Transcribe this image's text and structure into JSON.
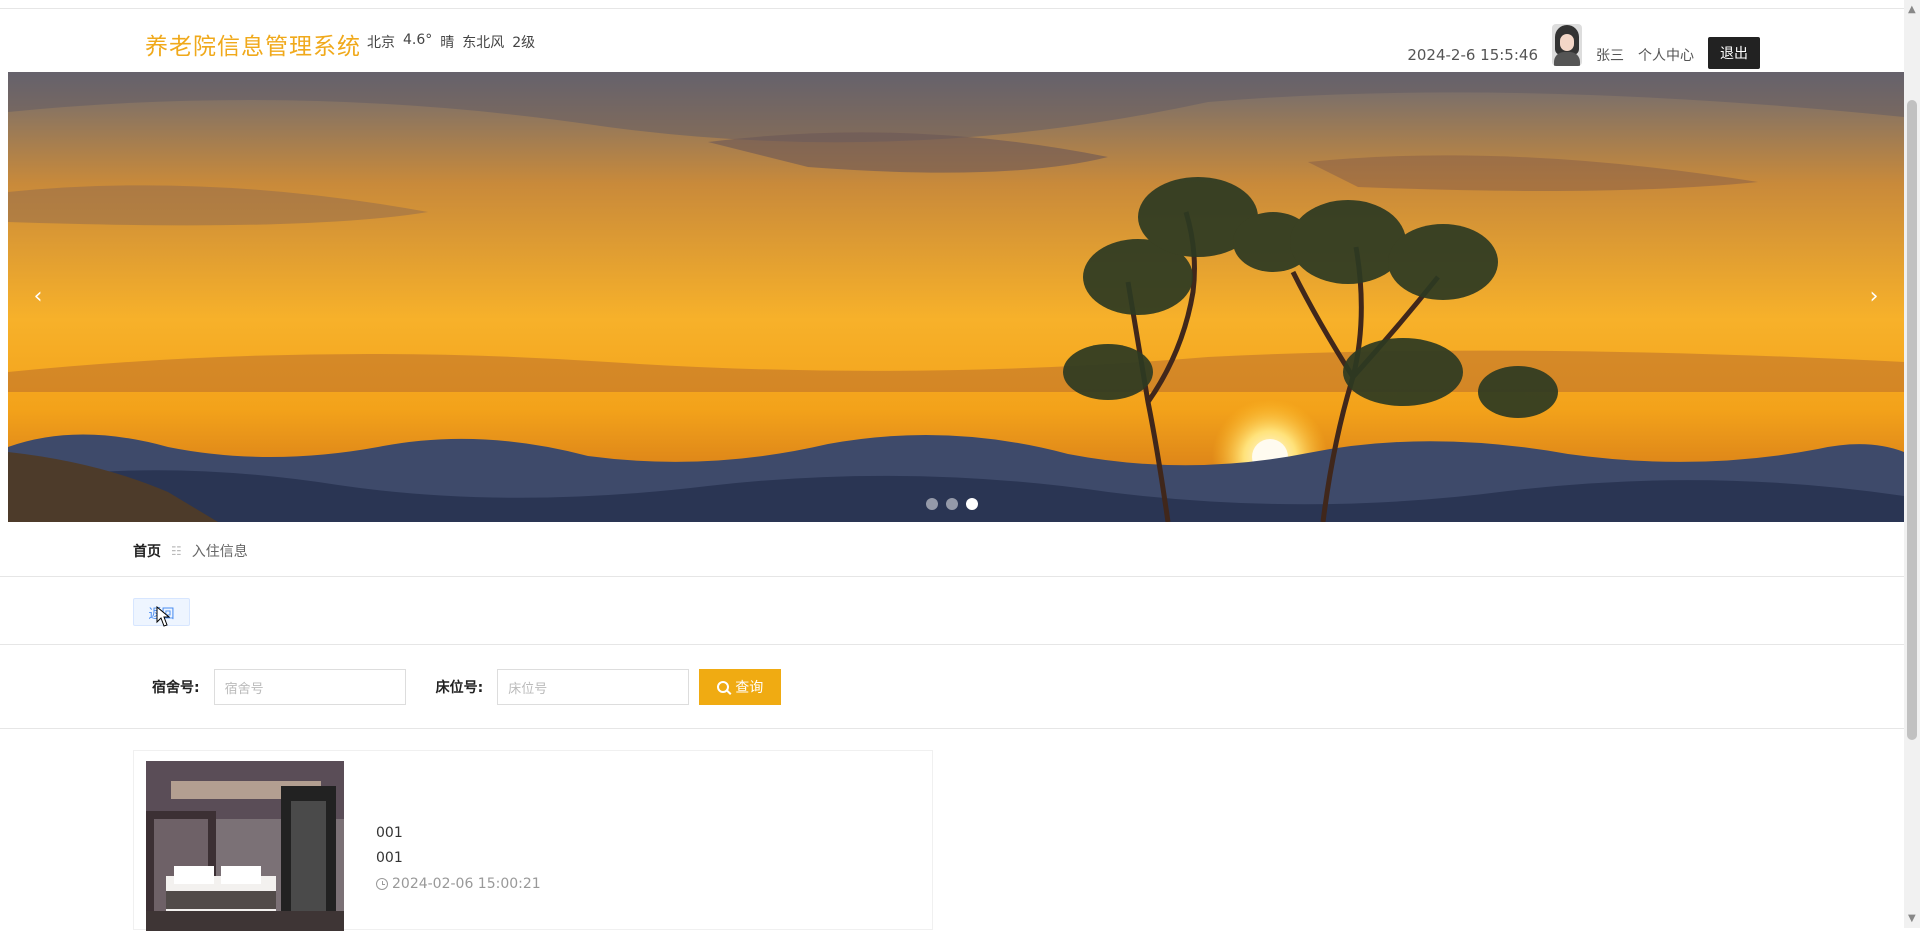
{
  "header": {
    "system_title": "养老院信息管理系统",
    "weather": {
      "city": "北京",
      "temp": "4.6°",
      "condition": "晴",
      "wind": "东北风",
      "level": "2级"
    },
    "datetime": "2024-2-6 15:5:46",
    "username": "张三",
    "personal_center": "个人中心",
    "logout": "退出"
  },
  "carousel": {
    "prev": "‹",
    "next": "›",
    "slide_count": 3,
    "active_index": 2
  },
  "breadcrumb": {
    "home": "首页",
    "separator": "☷",
    "current": "入住信息"
  },
  "actions": {
    "back_label": "返回"
  },
  "search": {
    "dorm_label": "宿舍号:",
    "dorm_placeholder": "宿舍号",
    "bed_label": "床位号:",
    "bed_placeholder": "床位号",
    "button_label": "查询"
  },
  "record": {
    "line1": "001",
    "line2": "001",
    "timestamp": "2024-02-06 15:00:21"
  },
  "colors": {
    "brand": "#f0a91b",
    "primary_button": "#f0ab12",
    "logout_bg": "#222222",
    "back_button_text": "#4a8df0"
  }
}
